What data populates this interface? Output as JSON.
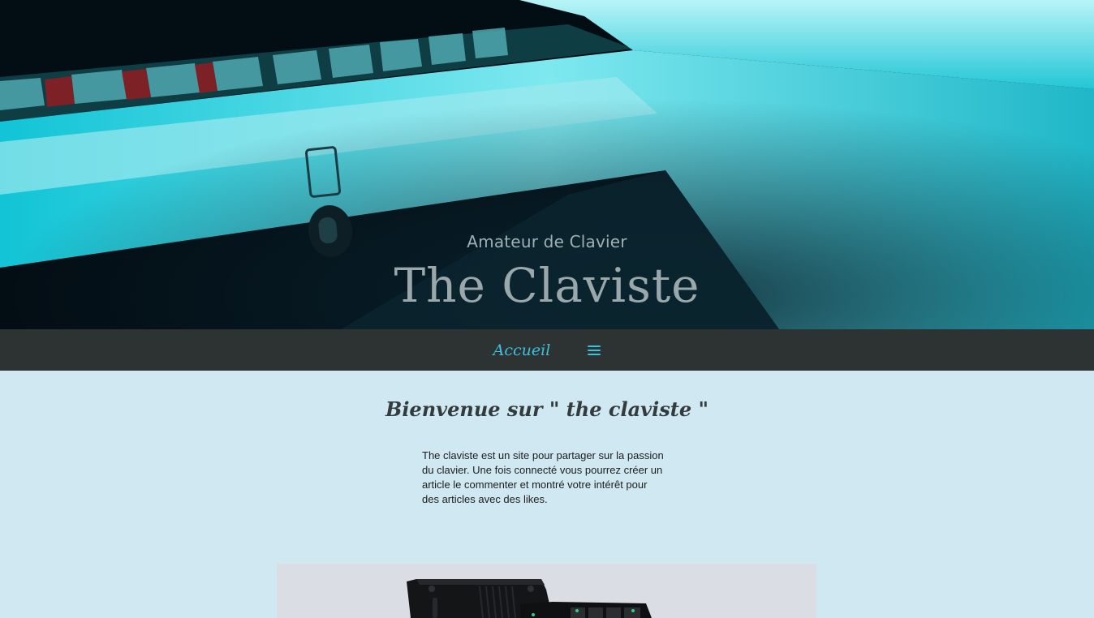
{
  "hero": {
    "subtitle": "Amateur de Clavier",
    "title": "The Claviste",
    "image_alt": "keyboard-hero-image"
  },
  "nav": {
    "home_label": "Accueil",
    "menu_icon": "hamburger-menu-icon",
    "accent_color": "#3fc0dc"
  },
  "main": {
    "heading": "Bienvenue sur \" the claviste \"",
    "intro_line1": "The claviste est un site pour partager sur la passion du clavier. Une fois connecté vous pourrez créer un article le commenter et montré votre intérêt pour",
    "intro_line2": "des articles avec des likes.",
    "product_image": "macropad-product-image"
  },
  "colors": {
    "page_bg": "#d0e8f2",
    "nav_bg": "#2d3233",
    "heading": "#333b3d"
  }
}
